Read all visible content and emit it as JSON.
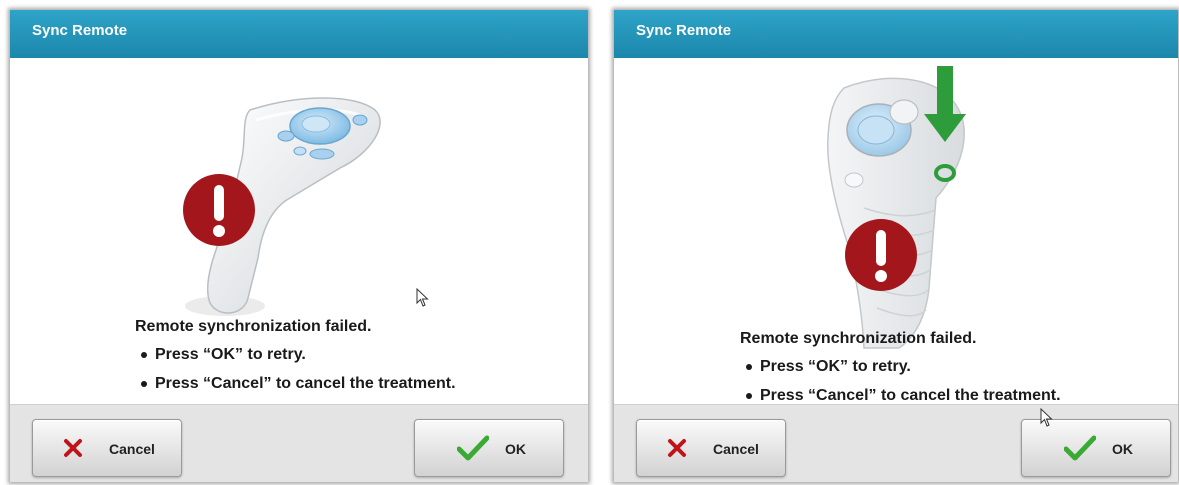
{
  "dialogs": [
    {
      "title": "Sync Remote",
      "message": "Remote synchronization failed.",
      "bullets": [
        "Press “OK” to retry.",
        "Press “Cancel” to cancel the treatment."
      ],
      "cancel_label": "Cancel",
      "ok_label": "OK"
    },
    {
      "title": "Sync Remote",
      "message": "Remote synchronization failed.",
      "bullets": [
        "Press “OK” to retry.",
        "Press “Cancel” to cancel the treatment."
      ],
      "cancel_label": "Cancel",
      "ok_label": "OK"
    }
  ],
  "colors": {
    "title_bar": "#1f93b9",
    "error_red": "#a3171c",
    "check_green": "#3aaa35",
    "cancel_red": "#c0141b",
    "arrow_green": "#2e9c3a"
  },
  "icons": [
    "error-icon",
    "remote-illustration",
    "green-down-arrow-icon",
    "cancel-x-icon",
    "checkmark-icon",
    "mouse-cursor-icon"
  ]
}
